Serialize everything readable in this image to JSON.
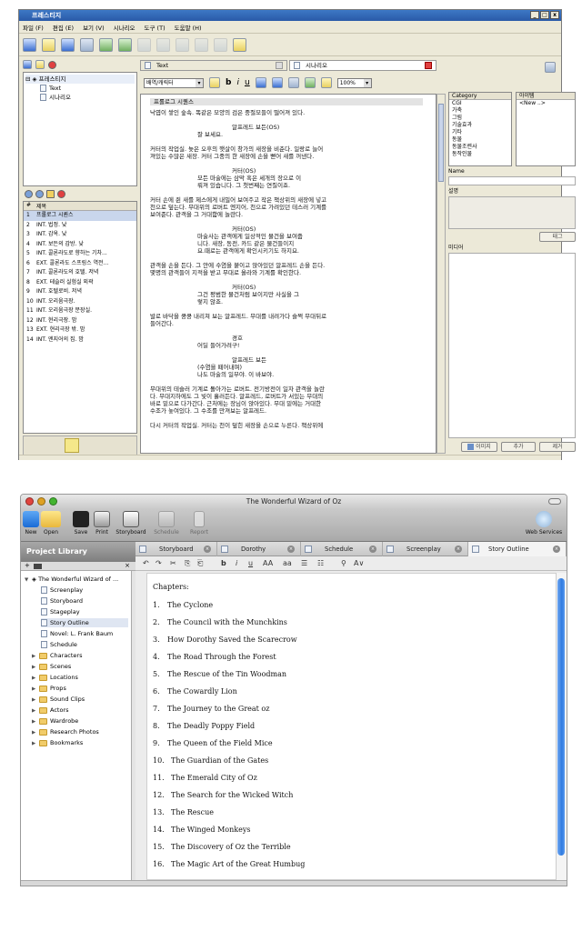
{
  "win1": {
    "title": "프레스티지",
    "menu": [
      "파일 (F)",
      "편집 (E)",
      "보기 (V)",
      "시나리오",
      "도구 (T)",
      "도움말 (H)"
    ],
    "tree": {
      "root": "프레스티지",
      "children": [
        "Text",
        "시나리오"
      ]
    },
    "scene_list": {
      "headers": [
        "#",
        "제목"
      ],
      "rows": [
        [
          "1",
          "프롤로그 시퀀스"
        ],
        [
          "2",
          "INT. 법정. 낮"
        ],
        [
          "3",
          "INT. 감옥. 낮"
        ],
        [
          "4",
          "INT. 보든의 감방. 낮"
        ],
        [
          "5",
          "INT. 콜론라도로 향하는 기차..."
        ],
        [
          "6",
          "EXT. 콜론라도 스프링스 역전..."
        ],
        [
          "7",
          "INT. 콜론라도의 호텔. 저녁"
        ],
        [
          "8",
          "EXT. 테슬러 실험실 외곽"
        ],
        [
          "9",
          "INT. 호텔로비. 저녁"
        ],
        [
          "10",
          "INT. 오리움극장."
        ],
        [
          "11",
          "INT. 오리움극장 분장실."
        ],
        [
          "12",
          "INT. 현리극장. 밤"
        ],
        [
          "13",
          "EXT. 현리극장 밖. 밤"
        ],
        [
          "14",
          "INT. 엔지어의 집. 밤"
        ]
      ]
    },
    "tabs": [
      "Text",
      "시나리오"
    ],
    "format": {
      "style": "배역/캐릭터",
      "zoom": "100%",
      "bold": "b",
      "italic": "i",
      "underline": "u"
    },
    "doc_lines": [
      {
        "t": "h",
        "s": "프롤로그 시퀀스"
      },
      {
        "t": "a",
        "s": "낙엽이 쌓인 숲속. 똑같은 모양의 검은 중절모들이 떨어져 있다."
      },
      {
        "t": "g",
        "s": ""
      },
      {
        "t": "c",
        "s": "알프레드 보든(OS)"
      },
      {
        "t": "d",
        "s": "잘 보세요."
      },
      {
        "t": "g",
        "s": ""
      },
      {
        "t": "a",
        "s": "커터의 작업실. 늦은 오후의 햇살이 창가의 새장을 비춘다. 일랑로 늘어"
      },
      {
        "t": "a",
        "s": "져있는 수많은 새장. 커터 그중의 한 새장에 손을 뻗어 새를 꺼낸다."
      },
      {
        "t": "g",
        "s": ""
      },
      {
        "t": "c",
        "s": "커터(OS)"
      },
      {
        "t": "d",
        "s": "모든 마술에는 삼막 혹은 세개의 장으로 이"
      },
      {
        "t": "d",
        "s": "뤄져 있습니다. 그 첫번째는 연질이죠."
      },
      {
        "t": "g",
        "s": ""
      },
      {
        "t": "a",
        "s": "커터 손에 쥔 새를 제스에게 내밀어 보여주고 작은 책상위의 새장에 넣고"
      },
      {
        "t": "a",
        "s": "천으로 덮는다. 무대위의 로버트 엔지어, 천으로 가려있던 테스러 기계를"
      },
      {
        "t": "a",
        "s": "보여준다. 관객을 그 거대함에 놀란다."
      },
      {
        "t": "g",
        "s": ""
      },
      {
        "t": "c",
        "s": "커터(OS)"
      },
      {
        "t": "d",
        "s": "마술사는 관객에게 일상적인 물건을 보여줍"
      },
      {
        "t": "d",
        "s": "니다. 새장, 동전, 카드 같은 물건들이지"
      },
      {
        "t": "d",
        "s": "요.때로는 관객에게 확인시키기도 하지요."
      },
      {
        "t": "g",
        "s": ""
      },
      {
        "t": "a",
        "s": "관객을 손을 든다. 그 안에 수염을 붙이고 앉아있던 알프레드 손을 든다."
      },
      {
        "t": "a",
        "s": "몇명의 관객들이 지적을 받고 무대로 올라와 기계를 확인한다."
      },
      {
        "t": "g",
        "s": ""
      },
      {
        "t": "c",
        "s": "커터(OS)"
      },
      {
        "t": "d",
        "s": "그건 평범한 물건처럼 보이지만 사실을 그"
      },
      {
        "t": "d",
        "s": "렇지 않죠."
      },
      {
        "t": "g",
        "s": ""
      },
      {
        "t": "a",
        "s": "발로 바닥을 쿵쿵 내리쳐 보는 알프레드. 무대를 내려가다 슬쩍 무대뒤로"
      },
      {
        "t": "a",
        "s": "들어간다."
      },
      {
        "t": "g",
        "s": ""
      },
      {
        "t": "c",
        "s": "경호"
      },
      {
        "t": "d",
        "s": "어딜 들어가려구!"
      },
      {
        "t": "g",
        "s": ""
      },
      {
        "t": "c",
        "s": "알프레드 보든"
      },
      {
        "t": "d",
        "s": "     (수염을 떼어내며)"
      },
      {
        "t": "d",
        "s": "나도 마술의 일부야. 이 바보야."
      },
      {
        "t": "g",
        "s": ""
      },
      {
        "t": "a",
        "s": "무대위의 테슬러 기계로 돌아가는 로버트. 전기방전이 일자 관객을 놀란"
      },
      {
        "t": "a",
        "s": "다. 무대지하에도 그 빛이 흘러든다. 알프레드, 로버트가 서있는 무대의"
      },
      {
        "t": "a",
        "s": "바로 밑으로 다가간다. 근처에는 장님이 앉아있다. 무대 밑에는 거대한"
      },
      {
        "t": "a",
        "s": "수조가 놓여있다. 그 수조를 만져보는 알프레드."
      },
      {
        "t": "g",
        "s": ""
      },
      {
        "t": "a",
        "s": "다시 커터의 작업실. 커터는 천이 덮힌 새장을 손으로 누른다. 책상위에"
      }
    ],
    "right": {
      "category_head": "Category",
      "categories": [
        "CGI",
        "가축",
        "그림",
        "기술효과",
        "기타",
        "동물",
        "동물조련사",
        "동작인물"
      ],
      "items_head": "아이템",
      "items": [
        "<New ..>"
      ],
      "name_label": "Name",
      "desc_label": "설명",
      "tag_button": "태그",
      "media_label": "미디어",
      "btn_add": "이미지",
      "btn_plus": "추가",
      "btn_remove": "제거"
    }
  },
  "win2": {
    "title": "The Wonderful Wizard of Oz",
    "toolbar": [
      "New",
      "Open",
      "Save",
      "Print",
      "Storyboard",
      "Schedule",
      "Report"
    ],
    "web_services": "Web Services",
    "library_title": "Project Library",
    "library_bar": {
      "plus": "+",
      "close": "×"
    },
    "library": {
      "root": "The Wonderful Wizard of ...",
      "docs": [
        "Screenplay",
        "Storyboard",
        "Stageplay",
        "Story Outline",
        "Novel: L. Frank Baum",
        "Schedule"
      ],
      "folders": [
        "Characters",
        "Scenes",
        "Locations",
        "Props",
        "Sound Clips",
        "Actors",
        "Wardrobe",
        "Research Photos",
        "Bookmarks"
      ]
    },
    "tabs": [
      "Storyboard",
      "Dorothy",
      "Schedule",
      "Screenplay",
      "Story Outline"
    ],
    "format": {
      "undo": "↶",
      "redo": "↷",
      "cut": "✂",
      "copy": "⎘",
      "paste": "⎗",
      "bold": "b",
      "italic": "i",
      "underline": "u",
      "aa_up": "AA",
      "aa_down": "aa",
      "list1": "☰",
      "list2": "☷",
      "search": "⚲",
      "font_size": "A∨"
    },
    "chapters_heading": "Chapters:",
    "chapters": [
      {
        "n": "1.",
        "t": "The Cyclone"
      },
      {
        "n": "2.",
        "t": "The Council with the Munchkins"
      },
      {
        "n": "3.",
        "t": "How Dorothy Saved the Scarecrow"
      },
      {
        "n": "4.",
        "t": "The Road Through the Forest"
      },
      {
        "n": "5.",
        "t": "The Rescue of the Tin Woodman"
      },
      {
        "n": "6.",
        "t": "The Cowardly Lion"
      },
      {
        "n": "7.",
        "t": "The Journey to the Great oz"
      },
      {
        "n": "8.",
        "t": "The Deadly Poppy Field"
      },
      {
        "n": "9.",
        "t": "The Queen of the Field Mice"
      },
      {
        "n": "10.",
        "t": "The Guardian of the Gates"
      },
      {
        "n": "11.",
        "t": "The Emerald City of Oz"
      },
      {
        "n": "12.",
        "t": "The Search for the Wicked Witch"
      },
      {
        "n": "13.",
        "t": "The Rescue"
      },
      {
        "n": "14.",
        "t": "The Winged Monkeys"
      },
      {
        "n": "15.",
        "t": "The Discovery of Oz the Terrible"
      },
      {
        "n": "16.",
        "t": "The Magic Art of the Great Humbug"
      }
    ]
  }
}
